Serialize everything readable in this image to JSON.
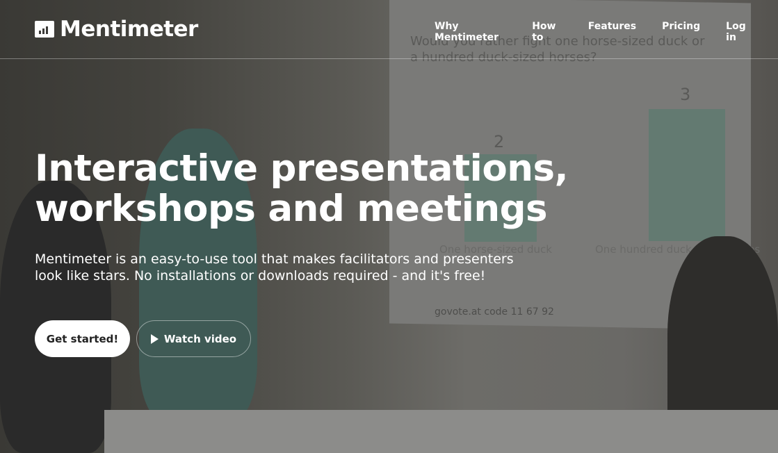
{
  "header": {
    "brand": "Mentimeter",
    "nav": [
      "Why Mentimeter",
      "How to",
      "Features",
      "Pricing",
      "Log in"
    ]
  },
  "hero": {
    "title_line1": "Interactive presentations,",
    "title_line2": "workshops and meetings",
    "subtitle_line1": "Mentimeter is an easy-to-use tool that makes facilitators and presenters",
    "subtitle_line2": "look like stars. No installations or downloads required - and it's free!",
    "get_started": "Get started!",
    "watch_video": "Watch video"
  },
  "background_slide": {
    "question": "Would you rather fight one horse-sized duck or a hundred duck-sized horses?",
    "options": [
      {
        "label": "One horse-sized duck",
        "votes": "2"
      },
      {
        "label": "One hundred duck-sized horses",
        "votes": "3"
      }
    ],
    "code": "govote.at code 11 67 92"
  }
}
